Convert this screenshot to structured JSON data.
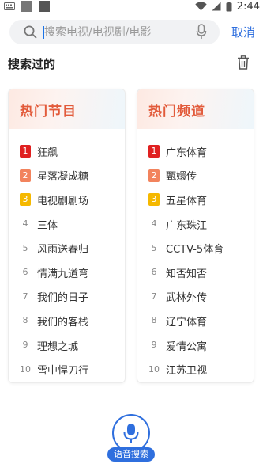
{
  "status_bar": {
    "time": "2:44"
  },
  "search": {
    "placeholder": "搜索电视/电视剧/电影",
    "cancel_label": "取消"
  },
  "history": {
    "title": "搜索过的"
  },
  "hot_programs": {
    "title": "热门节目",
    "items": [
      {
        "rank": "1",
        "name": "狂飙"
      },
      {
        "rank": "2",
        "name": "星落凝成糖"
      },
      {
        "rank": "3",
        "name": "电视剧剧场"
      },
      {
        "rank": "4",
        "name": "三体"
      },
      {
        "rank": "5",
        "name": "风雨送春归"
      },
      {
        "rank": "6",
        "name": "情满九道弯"
      },
      {
        "rank": "7",
        "name": "我们的日子"
      },
      {
        "rank": "8",
        "name": "我们的客栈"
      },
      {
        "rank": "9",
        "name": "理想之城"
      },
      {
        "rank": "10",
        "name": "雪中悍刀行"
      }
    ]
  },
  "hot_channels": {
    "title": "热门频道",
    "items": [
      {
        "rank": "1",
        "name": "广东体育"
      },
      {
        "rank": "2",
        "name": "甄嬛传"
      },
      {
        "rank": "3",
        "name": "五星体育"
      },
      {
        "rank": "4",
        "name": "广东珠江"
      },
      {
        "rank": "5",
        "name": "CCTV-5体育"
      },
      {
        "rank": "6",
        "name": "知否知否"
      },
      {
        "rank": "7",
        "name": "武林外传"
      },
      {
        "rank": "8",
        "name": "辽宁体育"
      },
      {
        "rank": "9",
        "name": "爱情公寓"
      },
      {
        "rank": "10",
        "name": "江苏卫视"
      }
    ]
  },
  "voice_search": {
    "label": "语音搜索"
  },
  "colors": {
    "accent": "#2f6fde",
    "card_title": "#e25a3a",
    "rank1": "#e02020",
    "rank2": "#f2835d",
    "rank3": "#f5b800"
  },
  "icons": [
    "keyboard-icon",
    "wifi-icon",
    "signal-icon",
    "battery-icon",
    "search-icon",
    "microphone-icon",
    "trash-icon"
  ]
}
